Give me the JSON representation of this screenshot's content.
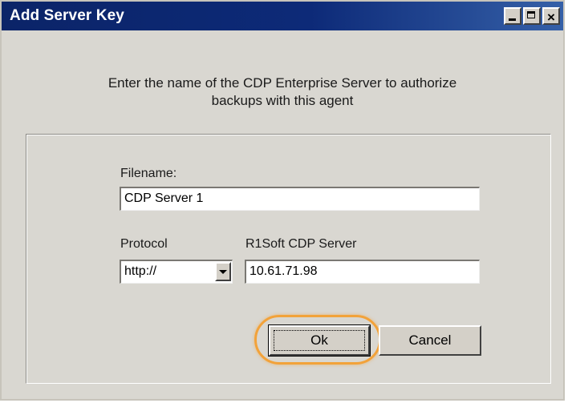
{
  "window": {
    "title": "Add Server Key",
    "controls": {
      "minimize_icon": "minimize-icon",
      "maximize_icon": "maximize-icon",
      "close_icon": "close-icon",
      "close_glyph": "×"
    }
  },
  "instructions": {
    "line1": "Enter the name of the CDP Enterprise Server to authorize",
    "line2": "backups with this agent"
  },
  "form": {
    "filename_label": "Filename:",
    "filename_value": "CDP Server 1",
    "protocol_label": "Protocol",
    "protocol_value": "http://",
    "server_label": "R1Soft CDP Server",
    "server_value": "10.61.71.98"
  },
  "buttons": {
    "ok_label": "Ok",
    "cancel_label": "Cancel"
  },
  "colors": {
    "titlebar": "#0b2468",
    "dialog_bg": "#d9d7d1",
    "highlight": "#f2a23a"
  }
}
